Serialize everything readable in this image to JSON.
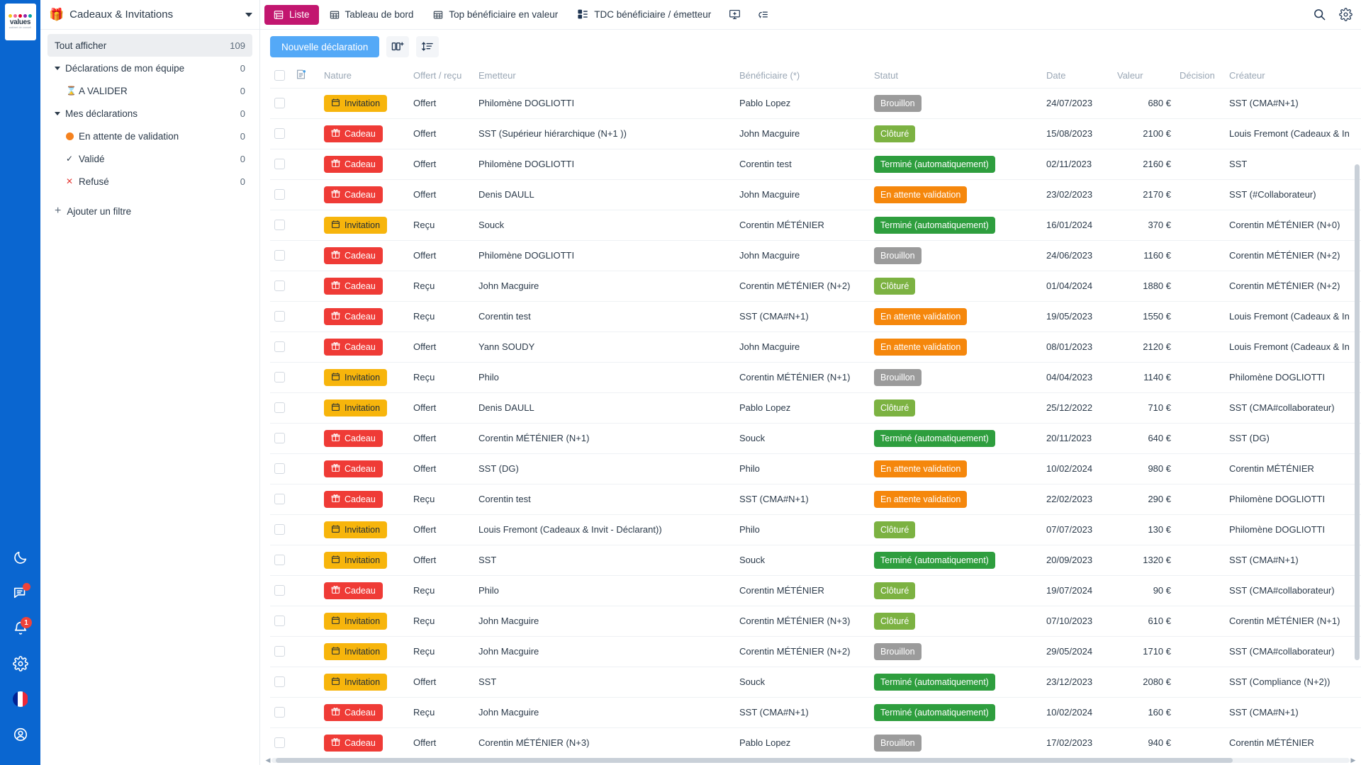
{
  "brand": {
    "word": "values",
    "sub": "cabinet de conseil",
    "dot_colors": [
      "#f5c518",
      "#f06292",
      "#e4002b",
      "#8e24aa",
      "#00a3a3"
    ]
  },
  "rail": {
    "items": [
      {
        "name": "dark-mode-icon",
        "label": "Mode sombre",
        "badge": ""
      },
      {
        "name": "messages-icon",
        "label": "Messages",
        "badge": "dot"
      },
      {
        "name": "notifications-icon",
        "label": "Notifications",
        "badge": "1"
      },
      {
        "name": "settings-icon",
        "label": "Paramètres",
        "badge": ""
      },
      {
        "name": "language-flag-icon",
        "label": "Français",
        "badge": ""
      },
      {
        "name": "account-icon",
        "label": "Mon compte",
        "badge": ""
      }
    ]
  },
  "sidebar": {
    "app_icon": "🎁",
    "title": "Cadeaux & Invitations",
    "items": [
      {
        "label": "Tout afficher",
        "count": "109",
        "type": "selected",
        "icon": ""
      },
      {
        "label": "Déclarations de mon équipe",
        "count": "0",
        "type": "group",
        "icon": "caret"
      },
      {
        "label": "A VALIDER",
        "count": "0",
        "type": "child",
        "icon": "⌛"
      },
      {
        "label": "Mes déclarations",
        "count": "0",
        "type": "group",
        "icon": "caret"
      },
      {
        "label": "En attente de validation",
        "count": "0",
        "type": "child",
        "icon": "dot-orange"
      },
      {
        "label": "Validé",
        "count": "0",
        "type": "child",
        "icon": "✓"
      },
      {
        "label": "Refusé",
        "count": "0",
        "type": "child",
        "icon": "✕"
      }
    ],
    "add_filter": "Ajouter un filtre"
  },
  "topbar": {
    "tabs": [
      {
        "label": "Liste",
        "icon": "list-icon",
        "active": true
      },
      {
        "label": "Tableau de bord",
        "icon": "dashboard-icon",
        "active": false
      },
      {
        "label": "Top bénéficiaire en valeur",
        "icon": "table-icon",
        "active": false
      },
      {
        "label": "TDC bénéficiaire / émetteur",
        "icon": "pivot-icon",
        "active": false
      }
    ],
    "actions": [
      {
        "name": "add-view-icon",
        "label": "Ajouter une vue"
      },
      {
        "name": "filter-list-icon",
        "label": "Filtres"
      }
    ],
    "right": [
      {
        "name": "search-icon",
        "label": "Rechercher"
      },
      {
        "name": "gear-icon",
        "label": "Paramètres"
      }
    ]
  },
  "toolbar": {
    "new_declaration": "Nouvelle déclaration",
    "columns_icon": "add-column-icon",
    "sort_icon": "sort-icon"
  },
  "table": {
    "columns": [
      "",
      "",
      "Nature",
      "Offert / reçu",
      "Emetteur",
      "Bénéficiaire (*)",
      "Statut",
      "Date",
      "Valeur",
      "Décision",
      "Créateur"
    ],
    "rows": [
      {
        "nature": "Invitation",
        "offert": "Offert",
        "emetteur": "Philomène DOGLIOTTI",
        "benef": "Pablo Lopez",
        "statut": "Brouillon",
        "statut_kind": "brouillon",
        "date": "24/07/2023",
        "valeur": "680 €",
        "decision": "",
        "createur": "SST (CMA#N+1)"
      },
      {
        "nature": "Cadeau",
        "offert": "Offert",
        "emetteur": "SST (Supérieur hiérarchique (N+1 ))",
        "benef": "John Macguire",
        "statut": "Clôturé",
        "statut_kind": "cloture",
        "date": "15/08/2023",
        "valeur": "2100 €",
        "decision": "",
        "createur": "Louis Fremont (Cadeaux & In"
      },
      {
        "nature": "Cadeau",
        "offert": "Offert",
        "emetteur": "Philomène DOGLIOTTI",
        "benef": "Corentin test",
        "statut": "Terminé (automatiquement)",
        "statut_kind": "termine",
        "date": "02/11/2023",
        "valeur": "2160 €",
        "decision": "",
        "createur": "SST"
      },
      {
        "nature": "Cadeau",
        "offert": "Offert",
        "emetteur": "Denis DAULL",
        "benef": "John Macguire",
        "statut": "En attente validation",
        "statut_kind": "attente",
        "date": "23/02/2023",
        "valeur": "2170 €",
        "decision": "",
        "createur": "SST (#Collaborateur)"
      },
      {
        "nature": "Invitation",
        "offert": "Reçu",
        "emetteur": "Souck",
        "benef": "Corentin MÉTÉNIER",
        "statut": "Terminé (automatiquement)",
        "statut_kind": "termine",
        "date": "16/01/2024",
        "valeur": "370 €",
        "decision": "",
        "createur": "Corentin MÉTÉNIER (N+0)"
      },
      {
        "nature": "Cadeau",
        "offert": "Offert",
        "emetteur": "Philomène DOGLIOTTI",
        "benef": "John Macguire",
        "statut": "Brouillon",
        "statut_kind": "brouillon",
        "date": "24/06/2023",
        "valeur": "1160 €",
        "decision": "",
        "createur": "Corentin MÉTÉNIER (N+2)"
      },
      {
        "nature": "Cadeau",
        "offert": "Reçu",
        "emetteur": "John Macguire",
        "benef": "Corentin MÉTÉNIER (N+2)",
        "statut": "Clôturé",
        "statut_kind": "cloture",
        "date": "01/04/2024",
        "valeur": "1880 €",
        "decision": "",
        "createur": "Corentin MÉTÉNIER (N+2)"
      },
      {
        "nature": "Cadeau",
        "offert": "Reçu",
        "emetteur": "Corentin test",
        "benef": "SST (CMA#N+1)",
        "statut": "En attente validation",
        "statut_kind": "attente",
        "date": "19/05/2023",
        "valeur": "1550 €",
        "decision": "",
        "createur": "Louis Fremont (Cadeaux & In"
      },
      {
        "nature": "Cadeau",
        "offert": "Offert",
        "emetteur": "Yann SOUDY",
        "benef": "John Macguire",
        "statut": "En attente validation",
        "statut_kind": "attente",
        "date": "08/01/2023",
        "valeur": "2120 €",
        "decision": "",
        "createur": "Louis Fremont (Cadeaux & In"
      },
      {
        "nature": "Invitation",
        "offert": "Reçu",
        "emetteur": "Philo",
        "benef": "Corentin MÉTÉNIER (N+1)",
        "statut": "Brouillon",
        "statut_kind": "brouillon",
        "date": "04/04/2023",
        "valeur": "1140 €",
        "decision": "",
        "createur": "Philomène DOGLIOTTI"
      },
      {
        "nature": "Invitation",
        "offert": "Offert",
        "emetteur": "Denis DAULL",
        "benef": "Pablo Lopez",
        "statut": "Clôturé",
        "statut_kind": "cloture",
        "date": "25/12/2022",
        "valeur": "710 €",
        "decision": "",
        "createur": "SST (CMA#collaborateur)"
      },
      {
        "nature": "Cadeau",
        "offert": "Offert",
        "emetteur": "Corentin MÉTÉNIER (N+1)",
        "benef": "Souck",
        "statut": "Terminé (automatiquement)",
        "statut_kind": "termine",
        "date": "20/11/2023",
        "valeur": "640 €",
        "decision": "",
        "createur": "SST (DG)"
      },
      {
        "nature": "Cadeau",
        "offert": "Offert",
        "emetteur": "SST (DG)",
        "benef": "Philo",
        "statut": "En attente validation",
        "statut_kind": "attente",
        "date": "10/02/2024",
        "valeur": "980 €",
        "decision": "",
        "createur": "Corentin MÉTÉNIER"
      },
      {
        "nature": "Cadeau",
        "offert": "Reçu",
        "emetteur": "Corentin test",
        "benef": "SST (CMA#N+1)",
        "statut": "En attente validation",
        "statut_kind": "attente",
        "date": "22/02/2023",
        "valeur": "290 €",
        "decision": "",
        "createur": "Philomène DOGLIOTTI"
      },
      {
        "nature": "Invitation",
        "offert": "Offert",
        "emetteur": "Louis Fremont (Cadeaux & Invit - Déclarant))",
        "benef": "Philo",
        "statut": "Clôturé",
        "statut_kind": "cloture",
        "date": "07/07/2023",
        "valeur": "130 €",
        "decision": "",
        "createur": "Philomène DOGLIOTTI"
      },
      {
        "nature": "Invitation",
        "offert": "Offert",
        "emetteur": "SST",
        "benef": "Souck",
        "statut": "Terminé (automatiquement)",
        "statut_kind": "termine",
        "date": "20/09/2023",
        "valeur": "1320 €",
        "decision": "",
        "createur": "SST (CMA#N+1)"
      },
      {
        "nature": "Cadeau",
        "offert": "Reçu",
        "emetteur": "Philo",
        "benef": "Corentin MÉTÉNIER",
        "statut": "Clôturé",
        "statut_kind": "cloture",
        "date": "19/07/2024",
        "valeur": "90 €",
        "decision": "",
        "createur": "SST (CMA#collaborateur)"
      },
      {
        "nature": "Invitation",
        "offert": "Reçu",
        "emetteur": "John Macguire",
        "benef": "Corentin MÉTÉNIER (N+3)",
        "statut": "Clôturé",
        "statut_kind": "cloture",
        "date": "07/10/2023",
        "valeur": "610 €",
        "decision": "",
        "createur": "Corentin MÉTÉNIER (N+1)"
      },
      {
        "nature": "Invitation",
        "offert": "Reçu",
        "emetteur": "John Macguire",
        "benef": "Corentin MÉTÉNIER (N+2)",
        "statut": "Brouillon",
        "statut_kind": "brouillon",
        "date": "29/05/2024",
        "valeur": "1710 €",
        "decision": "",
        "createur": "SST (CMA#collaborateur)"
      },
      {
        "nature": "Invitation",
        "offert": "Offert",
        "emetteur": "SST",
        "benef": "Souck",
        "statut": "Terminé (automatiquement)",
        "statut_kind": "termine",
        "date": "23/12/2023",
        "valeur": "2080 €",
        "decision": "",
        "createur": "SST (Compliance (N+2))"
      },
      {
        "nature": "Cadeau",
        "offert": "Reçu",
        "emetteur": "John Macguire",
        "benef": "SST (CMA#N+1)",
        "statut": "Terminé (automatiquement)",
        "statut_kind": "termine",
        "date": "10/02/2024",
        "valeur": "160 €",
        "decision": "",
        "createur": "SST (CMA#N+1)"
      },
      {
        "nature": "Cadeau",
        "offert": "Offert",
        "emetteur": "Corentin MÉTÉNIER (N+3)",
        "benef": "Pablo Lopez",
        "statut": "Brouillon",
        "statut_kind": "brouillon",
        "date": "17/02/2023",
        "valeur": "940 €",
        "decision": "",
        "createur": "Corentin MÉTÉNIER"
      }
    ]
  },
  "colors": {
    "rail_blue": "#0a66d0",
    "tab_active": "#c2166f",
    "primary_button": "#54a9f7",
    "cadeau": "#ef3b36",
    "invitation": "#f7b50c",
    "brouillon": "#9b9b9b",
    "cloture": "#7cb242",
    "termine": "#2e9e3e",
    "attente": "#f5870c"
  }
}
